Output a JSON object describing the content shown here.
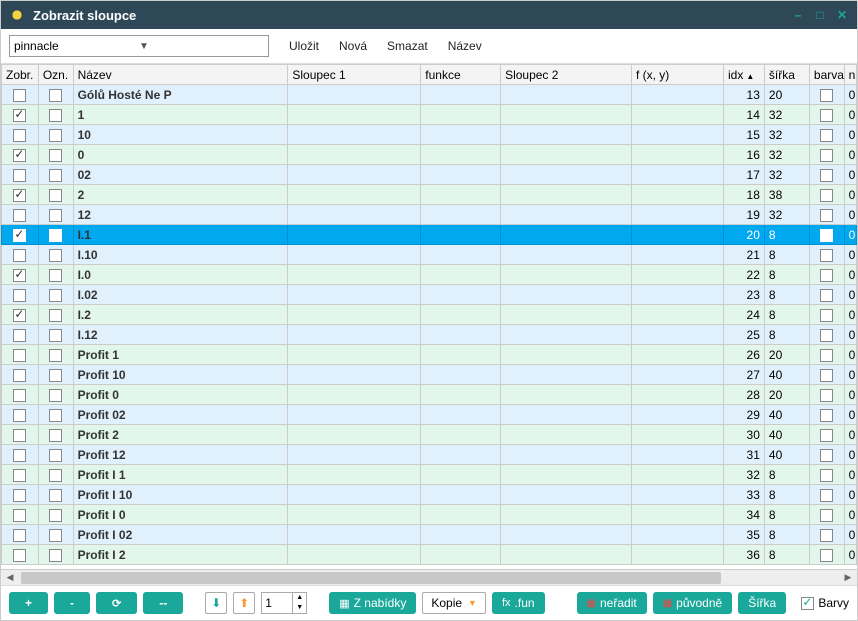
{
  "window": {
    "title": "Zobrazit sloupce"
  },
  "toolbar": {
    "combo_value": "pinnacle",
    "save": "Uložit",
    "new": "Nová",
    "delete": "Smazat",
    "name": "Název"
  },
  "columns": {
    "zobr": "Zobr.",
    "ozn": "Ozn.",
    "nazev": "Název",
    "sloupec1": "Sloupec 1",
    "funkce": "funkce",
    "sloupec2": "Sloupec 2",
    "fxy": "f (x, y)",
    "idx": "idx",
    "sirka": "šířka",
    "barva": "barva",
    "n": "n"
  },
  "rows": [
    {
      "zobr": false,
      "ozn": false,
      "nazev": "Gólů Hosté Ne P",
      "idx": 13,
      "sirka": 20,
      "barva": false,
      "n": 0,
      "sel": false
    },
    {
      "zobr": true,
      "ozn": false,
      "nazev": "1",
      "idx": 14,
      "sirka": 32,
      "barva": false,
      "n": 0,
      "sel": false
    },
    {
      "zobr": false,
      "ozn": false,
      "nazev": "10",
      "idx": 15,
      "sirka": 32,
      "barva": false,
      "n": 0,
      "sel": false
    },
    {
      "zobr": true,
      "ozn": false,
      "nazev": "0",
      "idx": 16,
      "sirka": 32,
      "barva": false,
      "n": 0,
      "sel": false
    },
    {
      "zobr": false,
      "ozn": false,
      "nazev": "02",
      "idx": 17,
      "sirka": 32,
      "barva": false,
      "n": 0,
      "sel": false
    },
    {
      "zobr": true,
      "ozn": false,
      "nazev": "2",
      "idx": 18,
      "sirka": 38,
      "barva": false,
      "n": 0,
      "sel": false
    },
    {
      "zobr": false,
      "ozn": false,
      "nazev": "12",
      "idx": 19,
      "sirka": 32,
      "barva": false,
      "n": 0,
      "sel": false
    },
    {
      "zobr": true,
      "ozn": false,
      "nazev": "I.1",
      "idx": 20,
      "sirka": 8,
      "barva": false,
      "n": 0,
      "sel": true
    },
    {
      "zobr": false,
      "ozn": false,
      "nazev": "I.10",
      "idx": 21,
      "sirka": 8,
      "barva": false,
      "n": 0,
      "sel": false
    },
    {
      "zobr": true,
      "ozn": false,
      "nazev": "I.0",
      "idx": 22,
      "sirka": 8,
      "barva": false,
      "n": 0,
      "sel": false
    },
    {
      "zobr": false,
      "ozn": false,
      "nazev": "I.02",
      "idx": 23,
      "sirka": 8,
      "barva": false,
      "n": 0,
      "sel": false
    },
    {
      "zobr": true,
      "ozn": false,
      "nazev": "I.2",
      "idx": 24,
      "sirka": 8,
      "barva": false,
      "n": 0,
      "sel": false
    },
    {
      "zobr": false,
      "ozn": false,
      "nazev": "I.12",
      "idx": 25,
      "sirka": 8,
      "barva": false,
      "n": 0,
      "sel": false
    },
    {
      "zobr": false,
      "ozn": false,
      "nazev": "Profit 1",
      "idx": 26,
      "sirka": 20,
      "barva": false,
      "n": 0,
      "sel": false
    },
    {
      "zobr": false,
      "ozn": false,
      "nazev": "Profit 10",
      "idx": 27,
      "sirka": 40,
      "barva": false,
      "n": 0,
      "sel": false
    },
    {
      "zobr": false,
      "ozn": false,
      "nazev": "Profit 0",
      "idx": 28,
      "sirka": 20,
      "barva": false,
      "n": 0,
      "sel": false
    },
    {
      "zobr": false,
      "ozn": false,
      "nazev": "Profit 02",
      "idx": 29,
      "sirka": 40,
      "barva": false,
      "n": 0,
      "sel": false
    },
    {
      "zobr": false,
      "ozn": false,
      "nazev": "Profit 2",
      "idx": 30,
      "sirka": 40,
      "barva": false,
      "n": 0,
      "sel": false
    },
    {
      "zobr": false,
      "ozn": false,
      "nazev": "Profit 12",
      "idx": 31,
      "sirka": 40,
      "barva": false,
      "n": 0,
      "sel": false
    },
    {
      "zobr": false,
      "ozn": false,
      "nazev": "Profit I 1",
      "idx": 32,
      "sirka": 8,
      "barva": false,
      "n": 0,
      "sel": false
    },
    {
      "zobr": false,
      "ozn": false,
      "nazev": "Profit I 10",
      "idx": 33,
      "sirka": 8,
      "barva": false,
      "n": 0,
      "sel": false
    },
    {
      "zobr": false,
      "ozn": false,
      "nazev": "Profit I 0",
      "idx": 34,
      "sirka": 8,
      "barva": false,
      "n": 0,
      "sel": false
    },
    {
      "zobr": false,
      "ozn": false,
      "nazev": "Profit I 02",
      "idx": 35,
      "sirka": 8,
      "barva": false,
      "n": 0,
      "sel": false
    },
    {
      "zobr": false,
      "ozn": false,
      "nazev": "Profit I 2",
      "idx": 36,
      "sirka": 8,
      "barva": false,
      "n": 0,
      "sel": false
    }
  ],
  "footer": {
    "plus": "+",
    "minus": "-",
    "refresh": "⟳",
    "dash": "--",
    "spin_value": "1",
    "z_nabidky": "Z nabídky",
    "kopie": "Kopie",
    "fun": ".fun",
    "neradit": "neřadit",
    "puvodne": "původně",
    "sirka": "Šířka",
    "barvy": "Barvy"
  }
}
